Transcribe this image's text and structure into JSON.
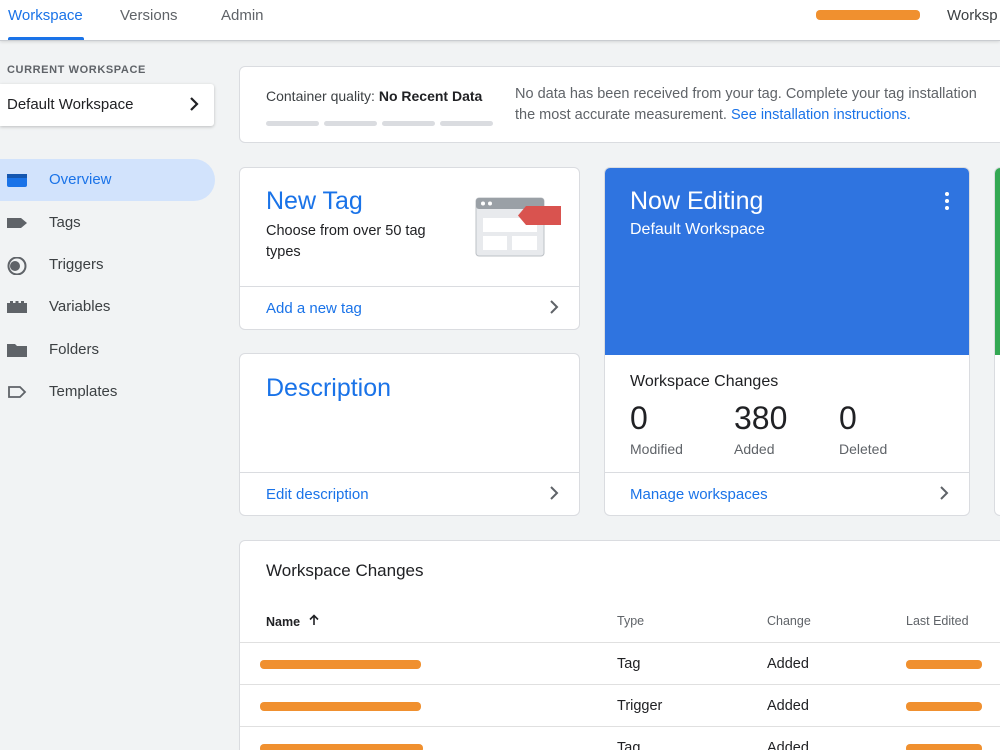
{
  "topnav": {
    "tabs": [
      "Workspace",
      "Versions",
      "Admin"
    ],
    "right_label": "Worksp"
  },
  "sidebar": {
    "current_workspace_label": "CURRENT WORKSPACE",
    "current_workspace_name": "Default Workspace",
    "items": [
      {
        "label": "Overview",
        "icon": "overview-icon",
        "active": true
      },
      {
        "label": "Tags",
        "icon": "tag-icon"
      },
      {
        "label": "Triggers",
        "icon": "trigger-icon"
      },
      {
        "label": "Variables",
        "icon": "variables-icon"
      },
      {
        "label": "Folders",
        "icon": "folder-icon"
      },
      {
        "label": "Templates",
        "icon": "template-icon"
      }
    ]
  },
  "quality": {
    "label": "Container quality:",
    "value": "No Recent Data",
    "message_line1": "No data has been received from your tag. Complete your tag installation",
    "message_line2": "the most accurate measurement.",
    "link": "See installation instructions."
  },
  "new_tag": {
    "title": "New Tag",
    "subtitle": "Choose from over 50 tag types",
    "link": "Add a new tag"
  },
  "description": {
    "title": "Description",
    "link": "Edit description"
  },
  "now_editing": {
    "title": "Now Editing",
    "workspace": "Default Workspace",
    "changes_title": "Workspace Changes",
    "stats": [
      {
        "value": "0",
        "label": "Modified"
      },
      {
        "value": "380",
        "label": "Added"
      },
      {
        "value": "0",
        "label": "Deleted"
      }
    ],
    "link": "Manage workspaces"
  },
  "workspace_changes": {
    "title": "Workspace Changes",
    "columns": [
      "Name",
      "Type",
      "Change",
      "Last Edited"
    ],
    "rows": [
      {
        "type": "Tag",
        "change": "Added"
      },
      {
        "type": "Trigger",
        "change": "Added"
      },
      {
        "type": "Tag",
        "change": "Added"
      }
    ]
  },
  "colors": {
    "accent": "#1a73e8",
    "editing_card": "#2f74e0",
    "redaction": "#f0902f"
  }
}
